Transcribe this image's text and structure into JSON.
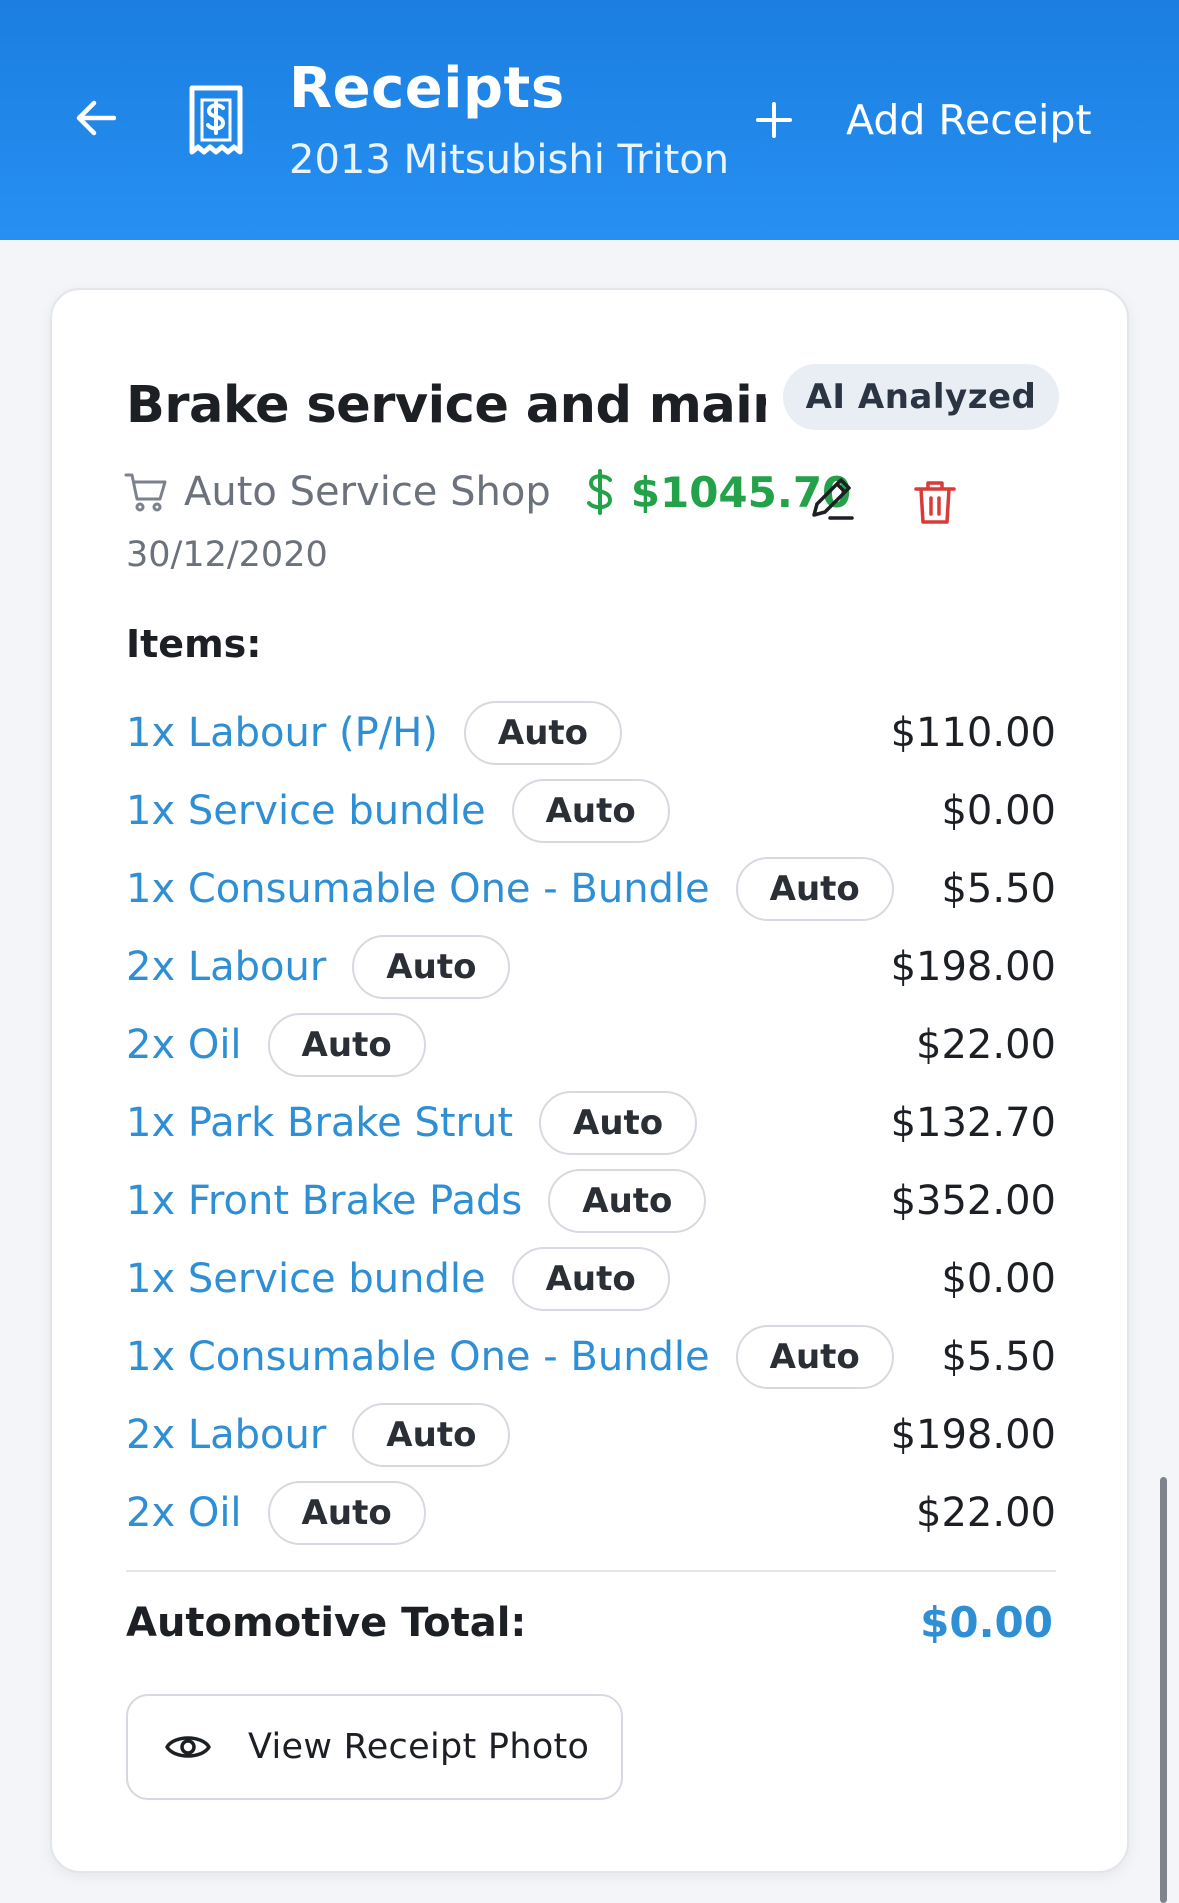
{
  "header": {
    "title": "Receipts",
    "subtitle": "2013 Mitsubishi Triton",
    "add_label": "Add Receipt",
    "icons": {
      "back": "arrow-left-icon",
      "receipt": "receipt-dollar-icon",
      "add": "plus-icon"
    },
    "background": "#1f86ea"
  },
  "receipt": {
    "title": "Brake service and maint...",
    "badge": "AI Analyzed",
    "merchant": "Auto Service Shop",
    "amount": "$1045.70",
    "date": "30/12/2020",
    "items_heading": "Items:",
    "items": [
      {
        "name": "1x Labour (P/H)",
        "tag": "Auto",
        "price": "$110.00"
      },
      {
        "name": "1x Service bundle",
        "tag": "Auto",
        "price": "$0.00"
      },
      {
        "name": "1x Consumable One - Bundle",
        "tag": "Auto",
        "price": "$5.50"
      },
      {
        "name": "2x Labour",
        "tag": "Auto",
        "price": "$198.00"
      },
      {
        "name": "2x Oil",
        "tag": "Auto",
        "price": "$22.00"
      },
      {
        "name": "1x Park Brake Strut",
        "tag": "Auto",
        "price": "$132.70"
      },
      {
        "name": "1x Front Brake Pads",
        "tag": "Auto",
        "price": "$352.00"
      },
      {
        "name": "1x Service bundle",
        "tag": "Auto",
        "price": "$0.00"
      },
      {
        "name": "1x Consumable One - Bundle",
        "tag": "Auto",
        "price": "$5.50"
      },
      {
        "name": "2x Labour",
        "tag": "Auto",
        "price": "$198.00"
      },
      {
        "name": "2x Oil",
        "tag": "Auto",
        "price": "$22.00"
      }
    ],
    "total_label": "Automotive Total:",
    "total_value": "$0.00",
    "view_photo_label": "View Receipt Photo",
    "icons": {
      "merchant": "cart-icon",
      "amount": "dollar-icon",
      "edit": "pencil-icon",
      "delete": "trash-icon",
      "view": "eye-icon"
    },
    "colors": {
      "amount": "#23a24a",
      "item_link": "#2f8fd5",
      "delete": "#d93b3b"
    }
  }
}
